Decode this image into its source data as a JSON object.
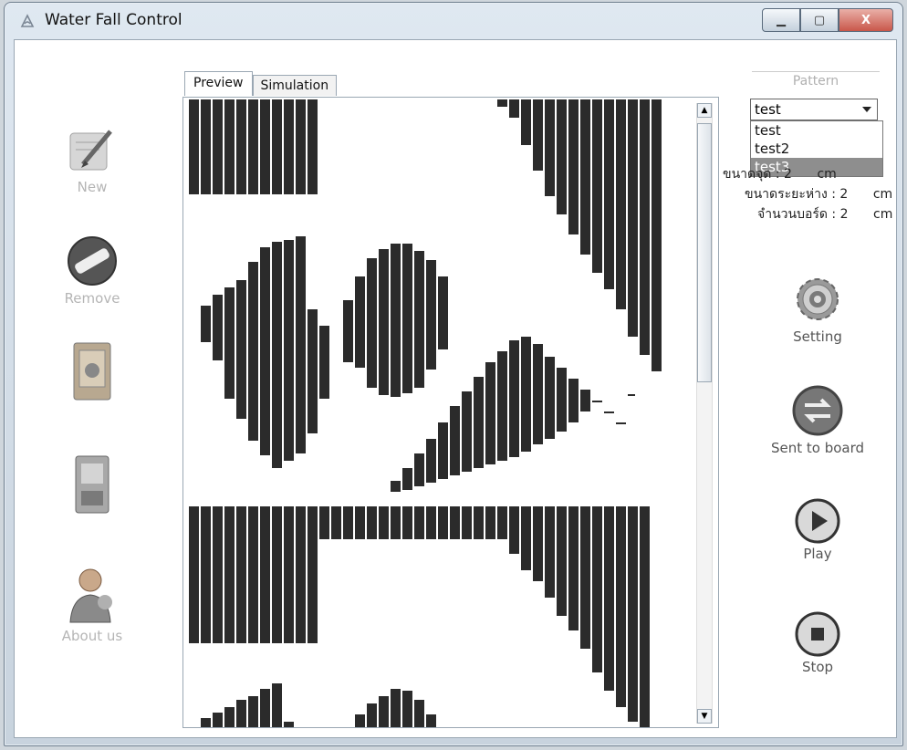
{
  "window": {
    "title": "Water Fall Control",
    "controls": {
      "minimize": "▁",
      "maximize": "▢",
      "close": "X"
    }
  },
  "sidebar": {
    "items": [
      {
        "label": "New",
        "icon": "pencil-paper-icon"
      },
      {
        "label": "Remove",
        "icon": "remove-icon"
      },
      {
        "label": "",
        "icon": "open-folder-icon"
      },
      {
        "label": "",
        "icon": "save-icon"
      },
      {
        "label": "About us",
        "icon": "user-icon"
      }
    ]
  },
  "tabs": [
    {
      "label": "Preview",
      "active": true
    },
    {
      "label": "Simulation",
      "active": false
    }
  ],
  "pattern": {
    "header": "Pattern",
    "selected": "test",
    "options": [
      "test",
      "test2",
      "test3"
    ],
    "highlighted": "test3"
  },
  "info": [
    {
      "label": "ขนาดจุด :",
      "value": "2",
      "unit": "cm"
    },
    {
      "label": "ขนาดระยะห่าง :",
      "value": "2",
      "unit": "cm"
    },
    {
      "label": "จำนวนบอร์ด :",
      "value": "2",
      "unit": "cm"
    }
  ],
  "actions": [
    {
      "label": "Setting",
      "icon": "gear-icon"
    },
    {
      "label": "Sent to board",
      "icon": "transfer-icon"
    },
    {
      "label": "Play",
      "icon": "play-icon"
    },
    {
      "label": "Stop",
      "icon": "stop-icon"
    }
  ],
  "colors": {
    "bars": "#2b2b2b",
    "selection": "#8e8e8e",
    "window_frame": "#c8d3de"
  }
}
